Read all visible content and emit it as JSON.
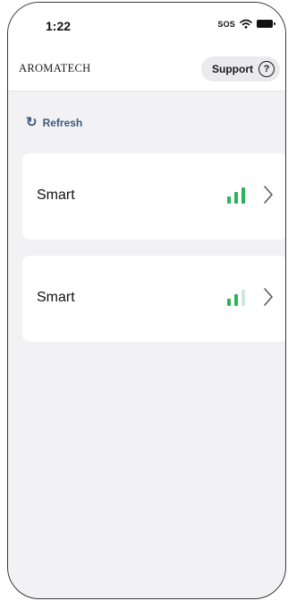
{
  "status_bar": {
    "time": "1:22",
    "sos": "SOS"
  },
  "header": {
    "brand": "AROMATECH",
    "support_label": "Support",
    "help_glyph": "?"
  },
  "refresh": {
    "icon": "refresh-icon",
    "label": "Refresh"
  },
  "devices": [
    {
      "name": "Smart",
      "signal_bars_active": 3,
      "signal_bars_total": 3
    },
    {
      "name": "Smart",
      "signal_bars_active": 2,
      "signal_bars_total": 3
    }
  ],
  "colors": {
    "signal_active": "#2bb35a",
    "signal_inactive": "#cfe9d6",
    "refresh": "#3b5a7a",
    "chevron": "#5a5a5a"
  }
}
